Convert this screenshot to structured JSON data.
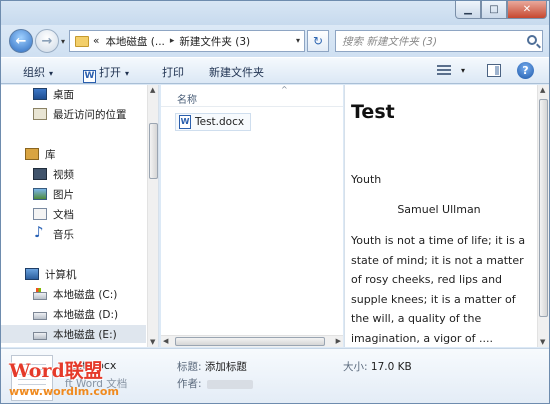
{
  "window": {
    "controls": {
      "minimize": "▁",
      "maximize": "□",
      "close": "✕"
    }
  },
  "address": {
    "overflow": "«",
    "crumbs": [
      "本地磁盘 (...",
      "新建文件夹 (3)"
    ],
    "separator": "▸",
    "dropdown": "▾",
    "refresh": "↻"
  },
  "search": {
    "placeholder": "搜索 新建文件夹 (3)"
  },
  "toolbar": {
    "organize": "组织",
    "open_icon": "W",
    "open": "打开",
    "print": "打印",
    "new_folder": "新建文件夹",
    "dropdown": "▾",
    "help": "?"
  },
  "nav": {
    "favorites": [
      {
        "label": "桌面",
        "icon": "desktop-icon"
      },
      {
        "label": "最近访问的位置",
        "icon": "recent-places-icon"
      }
    ],
    "libraries_header": "库",
    "libraries": [
      {
        "label": "视频",
        "icon": "video-icon"
      },
      {
        "label": "图片",
        "icon": "pictures-icon"
      },
      {
        "label": "文档",
        "icon": "documents-icon"
      },
      {
        "label": "音乐",
        "icon": "music-icon"
      }
    ],
    "computer_header": "计算机",
    "drives": [
      {
        "label": "本地磁盘 (C:)",
        "icon": "system-drive-icon"
      },
      {
        "label": "本地磁盘 (D:)",
        "icon": "drive-icon"
      },
      {
        "label": "本地磁盘 (E:)",
        "icon": "drive-icon",
        "selected": true
      }
    ]
  },
  "filelist": {
    "column_name": "名称",
    "sort_indicator": "^",
    "files": [
      {
        "name": "Test.docx",
        "icon": "word-document-icon"
      }
    ]
  },
  "preview": {
    "title": "Test",
    "heading": "Youth",
    "author": "Samuel Ullman",
    "body": "Youth is not a time of life; it is a state of mind; it is not a matter of rosy cheeks, red lips and supple knees; it is a matter of the will, a quality of the imagination, a vigor of ...."
  },
  "details": {
    "filename": "Test.docx",
    "filetype": "ft Word 文档",
    "title_label": "标题:",
    "title_value": "添加标题",
    "author_label": "作者:",
    "size_label": "大小:",
    "size_value": "17.0 KB"
  },
  "watermark": {
    "brand": "Word联盟",
    "url": "www.wordlm.com"
  }
}
